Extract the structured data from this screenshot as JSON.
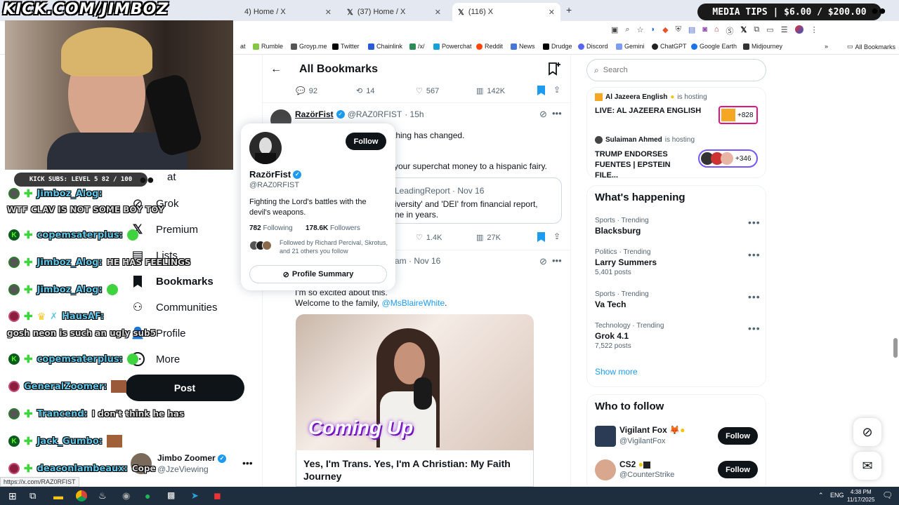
{
  "stream": {
    "overlay_url": "KICK.COM/JIMBOZ",
    "media_tips": "MEDIA TIPS | $6.00 / $200.00",
    "kick_subs": "KICK SUBS: LEVEL 5 82 / 100",
    "chat": [
      {
        "user": "Jimboz_Alog:",
        "message": "WTF CLAV IS NOT SOME BOY TOY",
        "badge": "gray"
      },
      {
        "user": "copemsaterplus:",
        "message": "",
        "badge": "kick"
      },
      {
        "user": "Jimboz_Alog:",
        "message": "HE HAS FEELINGS",
        "badge": "gray"
      },
      {
        "user": "Jimboz_Alog:",
        "message": "",
        "badge": "gray"
      },
      {
        "user": "HausAF:",
        "message": "gosh neon is such an ugly sub5",
        "badge": "red"
      },
      {
        "user": "copemsaterplus:",
        "message": "",
        "badge": "kick"
      },
      {
        "user": "GeneralZoomer:",
        "message": "",
        "badge": "red"
      },
      {
        "user": "Trancend:",
        "message": "I don't think he has",
        "badge": "gray"
      },
      {
        "user": "Jack_Gumbo:",
        "message": "",
        "badge": "kick"
      },
      {
        "user": "deaconlambeaux:",
        "message": "Cope",
        "badge": "red"
      }
    ]
  },
  "browser": {
    "tabs": [
      {
        "title": "4) Home / X"
      },
      {
        "title": "(37) Home / X"
      },
      {
        "title": "(116) X"
      }
    ],
    "new_tab": "+",
    "bookmarks": [
      "at",
      "Rumble",
      "Groyp.me",
      "Twitter",
      "Chainlink",
      "/x/",
      "Powerchat",
      "Reddit",
      "News",
      "Drudge",
      "Discord",
      "Gemini",
      "ChatGPT",
      "Google Earth",
      "Midjourney"
    ],
    "all_bookmarks": "All Bookmarks",
    "status_url": "https://x.com/RAZ0RFIST"
  },
  "sidebar": {
    "items": [
      {
        "label": "at"
      },
      {
        "label": "Grok"
      },
      {
        "label": "Premium"
      },
      {
        "label": "Lists"
      },
      {
        "label": "Bookmarks"
      },
      {
        "label": "Communities"
      },
      {
        "label": "Profile"
      },
      {
        "label": "More"
      }
    ],
    "post_button": "Post",
    "account": {
      "name": "Jimbo Zoomer",
      "handle": "@JzeViewing"
    }
  },
  "main": {
    "title": "All Bookmarks",
    "first_actions": {
      "replies": "92",
      "reposts": "14",
      "likes": "567",
      "views": "142K"
    },
    "tweet1": {
      "name": "RazörFist",
      "handle": "@RAZ0RFIST",
      "time": "· 15h",
      "line1_fragment": "thing has changed.",
      "line2_fragment": "your superchat money to a hispanic fairy.",
      "quote_header": "LeadingReport · Nov 16",
      "quote_text_1": "iversity' and 'DEI' from financial report,",
      "quote_text_2": "ne in years.",
      "likes": "1.4K",
      "views": "27K"
    },
    "tweet2": {
      "header_fragment": "am · Nov 16",
      "text_1": "I'm so excited about this.",
      "text_2": "Welcome to the family,",
      "mention": "@MsBlaireWhite",
      "text_3": ".",
      "video_overlay": "Coming Up",
      "card_title": "Yes, I'm Trans. Yes, I'm A Christian: My Faith Journey"
    }
  },
  "hovercard": {
    "name": "RazörFist",
    "handle": "@RAZ0RFIST",
    "follow": "Follow",
    "bio": "Fighting the Lord's battles with the devil's weapons.",
    "following_count": "782",
    "following_label": "Following",
    "followers_count": "178.6K",
    "followers_label": "Followers",
    "followed_by": "Followed by Richard Percival, Skrotus, and 21 others you follow",
    "profile_summary": "Profile Summary"
  },
  "right": {
    "search_placeholder": "Search",
    "spaces": [
      {
        "host": "Al Jazeera English",
        "status": "is hosting",
        "title": "LIVE: AL JAZEERA ENGLISH",
        "count": "+828"
      },
      {
        "host": "Sulaiman Ahmed",
        "status": "is hosting",
        "title": "TRUMP ENDORSES FUENTES | EPSTEIN FILE...",
        "count": "+346"
      }
    ],
    "whats_happening": "What's happening",
    "trends": [
      {
        "meta": "Sports · Trending",
        "title": "Blacksburg",
        "count": ""
      },
      {
        "meta": "Politics · Trending",
        "title": "Larry Summers",
        "count": "5,401 posts"
      },
      {
        "meta": "Sports · Trending",
        "title": "Va Tech",
        "count": ""
      },
      {
        "meta": "Technology · Trending",
        "title": "Grok 4.1",
        "count": "7,522 posts"
      }
    ],
    "show_more": "Show more",
    "who_to_follow": "Who to follow",
    "suggestions": [
      {
        "name": "Vigilant Fox",
        "handle": "@VigilantFox",
        "follow": "Follow"
      },
      {
        "name": "CS2",
        "handle": "@CounterStrike",
        "follow": "Follow"
      }
    ]
  },
  "taskbar": {
    "lang": "ENG",
    "time": "4:38 PM",
    "date": "11/17/2025"
  }
}
